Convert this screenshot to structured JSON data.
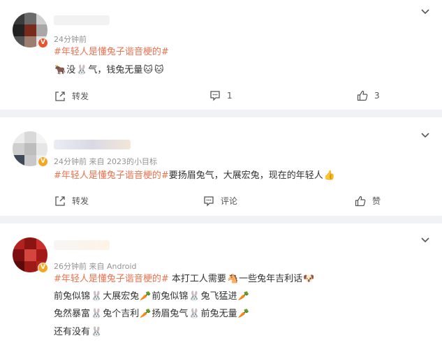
{
  "comments": [
    {
      "meta": "24分钟前",
      "hashtag": "#年轻人是懂兔子谐音梗的#",
      "line1_a": "没",
      "line1_b": "气，钱兔无量",
      "actions": {
        "repost": "转发",
        "comment_count": "1",
        "like_count": "3"
      },
      "badge": "V"
    },
    {
      "meta": "24分钟前  来自 2023的小目标",
      "hashtag": "#年轻人是懂兔子谐音梗的#",
      "body": "要扬眉兔气，大展宏兔，现在的年轻人",
      "actions": {
        "repost": "转发",
        "comment": "评论",
        "like": "赞"
      },
      "badge": "V"
    },
    {
      "meta": "26分钟前  来自 Android",
      "hashtag": "#年轻人是懂兔子谐音梗的#",
      "body_a": " 本打工人需要",
      "body_b": "一些兔年吉利话",
      "lines": [
        [
          "前兔似锦",
          "大展宏兔",
          "前兔似锦",
          "兔飞猛进"
        ],
        [
          "兔然暴富",
          "兔个吉利",
          "扬眉兔气",
          "前兔无量"
        ]
      ],
      "last": "还有没有",
      "badge": "V"
    }
  ],
  "icons": [
    "chevron-down-icon",
    "repost-icon",
    "comment-icon",
    "like-icon"
  ],
  "colors": {
    "hashtag": "#eb7350",
    "meta": "#939393",
    "separator": "#f1f2f5"
  }
}
